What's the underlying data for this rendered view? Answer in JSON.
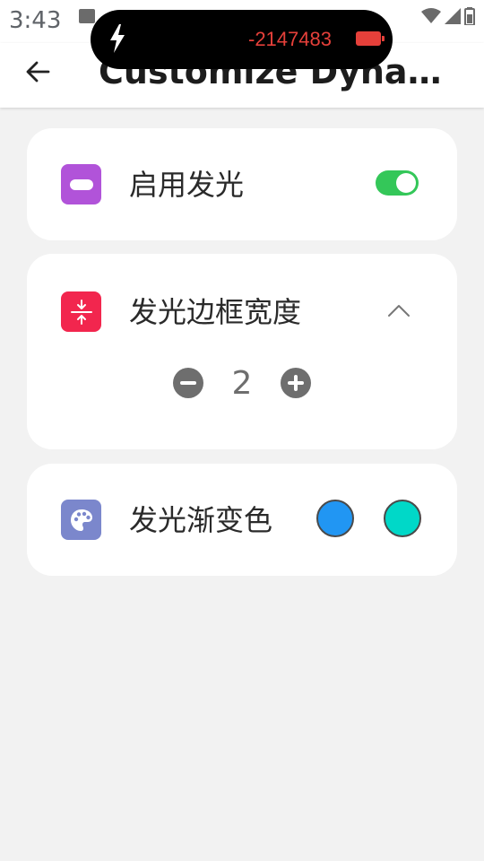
{
  "status_bar": {
    "time": "3:43"
  },
  "island": {
    "value": "-2147483"
  },
  "app_bar": {
    "title": "Customize Dynamic Island"
  },
  "settings": {
    "glow": {
      "label": "启用发光",
      "enabled": true,
      "icon": "capsule-icon",
      "icon_color": "#b153d9"
    },
    "border_width": {
      "label": "发光边框宽度",
      "value": "2",
      "icon": "compress-icon",
      "icon_color": "#f2264e"
    },
    "gradient": {
      "label": "发光渐变色",
      "icon": "palette-icon",
      "icon_color": "#7b87cc",
      "colors": [
        "#2196f3",
        "#00d8c8"
      ]
    }
  },
  "colors": {
    "toggle_on": "#34c759",
    "island_accent": "#e5403a"
  }
}
